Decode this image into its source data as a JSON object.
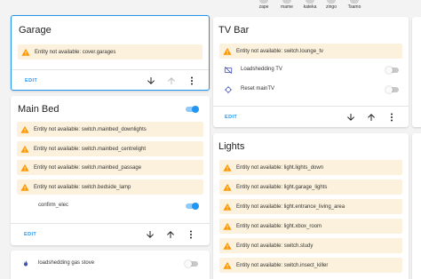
{
  "colors": {
    "accent": "#2196f3",
    "warning": "#ff9800",
    "warning_bg": "#fcf1dc",
    "background": "#f3f3f3"
  },
  "avatars": [
    "zape",
    "mame",
    "kateka",
    "zingo",
    "Tsamo"
  ],
  "garage_card": {
    "title": "Garage",
    "warnings": [
      "Entity not available: cover.garages"
    ],
    "edit_label": "EDIT",
    "icons": [
      "arrow-down-icon",
      "arrow-up-icon",
      "more-vert-icon"
    ]
  },
  "main_bed_card": {
    "title": "Main Bed",
    "title_toggle_on": true,
    "warnings": [
      "Entity not available: switch.mainbed_downlights",
      "Entity not available: switch.mainbed_centrelight",
      "Entity not available: switch.mainbed_passage",
      "Entity not available: switch.bedside_lamp"
    ],
    "entity_label": "confirm_elec",
    "entity_toggle_on": true,
    "edit_label": "EDIT"
  },
  "loadshedding_card": {
    "label": "loadshedding gas stove",
    "icon": "fire-icon",
    "toggle_on": false
  },
  "tv_bar_card": {
    "title": "TV Bar",
    "warnings": [
      "Entity not available: switch.lounge_tv"
    ],
    "rows": [
      {
        "label": "Loadshedding TV",
        "icon": "tv-off-icon",
        "toggle_on": false
      },
      {
        "label": "Reset mainTV",
        "icon": "reset-icon",
        "toggle_on": false
      }
    ],
    "edit_label": "EDIT"
  },
  "lights_card": {
    "title": "Lights",
    "warnings": [
      "Entity not available: light.lights_down",
      "Entity not available: light.garage_lights",
      "Entity not available: light.entrance_living_area",
      "Entity not available: light.xbox_room",
      "Entity not available: switch.study",
      "Entity not available: switch.insect_killer"
    ]
  }
}
